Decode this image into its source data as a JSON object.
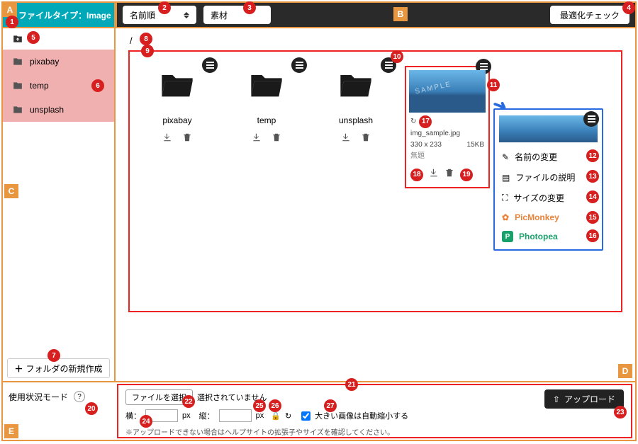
{
  "header": {
    "filetype_label": "ファイルタイプ：Image"
  },
  "toolbar": {
    "sort_label": "名前順",
    "material_label": "素材",
    "optimize_label": "最適化チェック"
  },
  "sidebar": {
    "folders": [
      {
        "name": "pixabay"
      },
      {
        "name": "temp"
      },
      {
        "name": "unsplash"
      }
    ],
    "new_folder_label": "フォルダの新規作成"
  },
  "breadcrumb": "/",
  "tiles": [
    {
      "name": "pixabay"
    },
    {
      "name": "temp"
    },
    {
      "name": "unsplash"
    }
  ],
  "image_tile": {
    "filename": "img_sample.jpg",
    "dims": "330 x 233",
    "size": "15KB",
    "alt_label": "無題"
  },
  "context_menu": {
    "rename": "名前の変更",
    "description": "ファイルの説明",
    "resize": "サイズの変更",
    "picmonkey": "PicMonkey",
    "photopea": "Photopea"
  },
  "bottom": {
    "usage_mode": "使用状況モード",
    "choose_file": "ファイルを選択",
    "no_file": "選択されていません",
    "width_label": "横：",
    "height_label": "縦：",
    "px": "px",
    "shrink_label": "大きい画像は自動縮小する",
    "upload": "アップロード",
    "note": "※アップロードできない場合はヘルプサイトの拡張子やサイズを確認してください。"
  },
  "annot": {
    "A": "A",
    "B": "B",
    "C": "C",
    "D": "D",
    "E": "E",
    "n1": "1",
    "n2": "2",
    "n3": "3",
    "n4": "4",
    "n5": "5",
    "n6": "6",
    "n7": "7",
    "n8": "8",
    "n9": "9",
    "n10": "10",
    "n11": "11",
    "n12": "12",
    "n13": "13",
    "n14": "14",
    "n15": "15",
    "n16": "16",
    "n17": "17",
    "n18": "18",
    "n19": "19",
    "n20": "20",
    "n21": "21",
    "n22": "22",
    "n23": "23",
    "n24": "24",
    "n25": "25",
    "n26": "26",
    "n27": "27"
  }
}
